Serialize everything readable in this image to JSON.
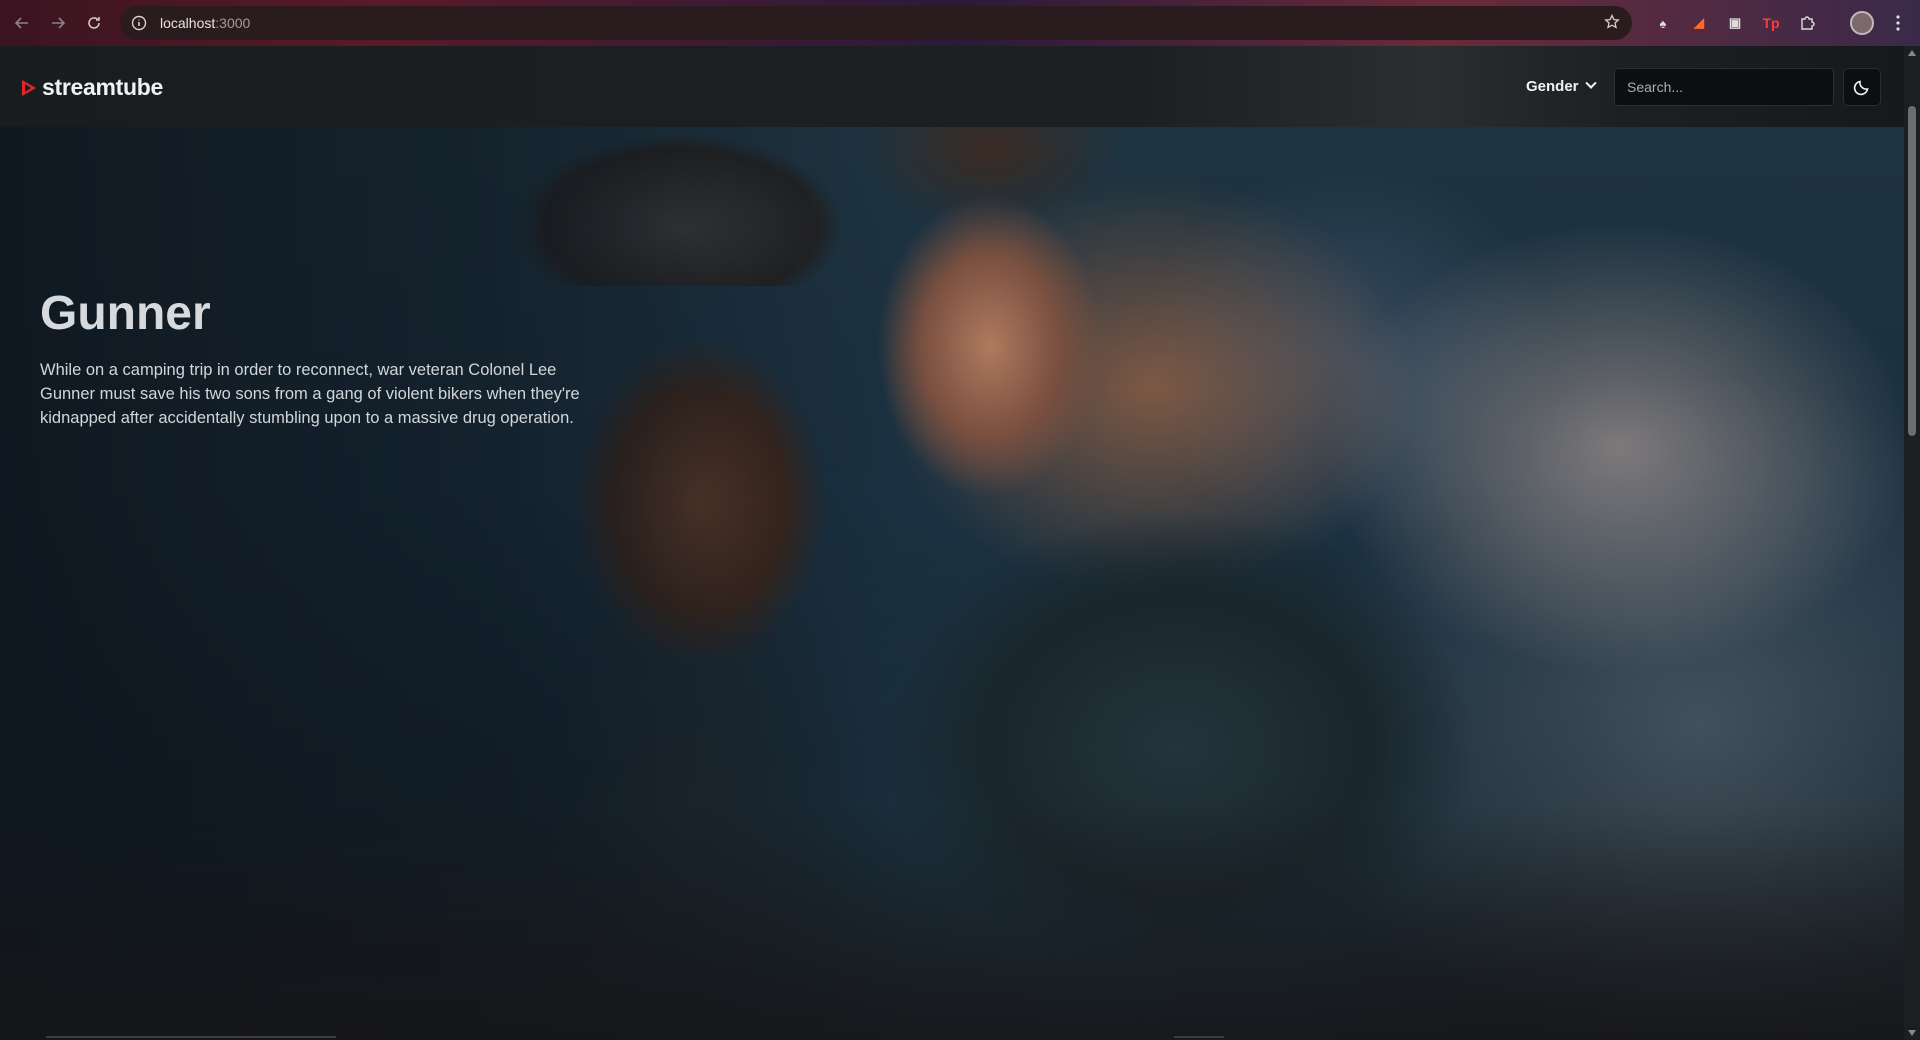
{
  "browser": {
    "url_host": "localhost",
    "url_port": ":3000"
  },
  "site": {
    "logo_text": "streamtube",
    "nav": {
      "gender_label": "Gender"
    },
    "search": {
      "placeholder": "Search..."
    },
    "theme_toggle_icon": "moon-icon"
  },
  "hero": {
    "title": "Gunner",
    "description": "While on a camping trip in order to reconnect, war veteran Colonel Lee Gunner must save his two sons from a gang of violent bikers when they're kidnapped after accidentally stumbling upon to a massive drug operation."
  },
  "colors": {
    "brand_red": "#e02828",
    "header_bg": "#1d2022",
    "input_bg": "#0c0f12"
  }
}
